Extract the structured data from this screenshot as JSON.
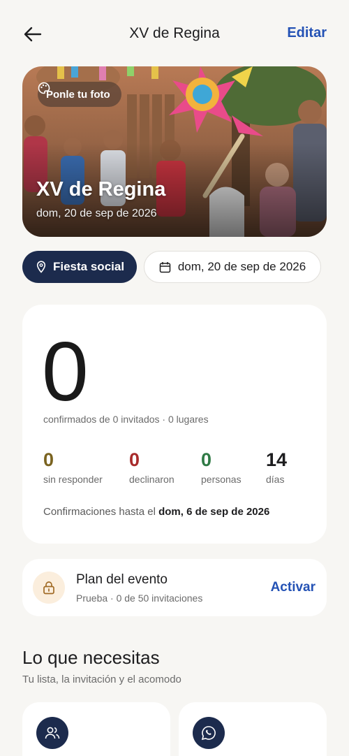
{
  "header": {
    "title": "XV de Regina",
    "edit_label": "Editar"
  },
  "hero": {
    "photo_chip_label": "Ponle tu foto",
    "title": "XV de Regina",
    "date": "dom, 20 de sep de 2026"
  },
  "pills": {
    "type_label": "Fiesta social",
    "date_label": "dom, 20 de sep de 2026"
  },
  "stats": {
    "confirmed_count": "0",
    "confirmed_text": "confirmados de 0 invitados · 0 lugares",
    "metrics": [
      {
        "value": "0",
        "label": "sin responder",
        "color": "#7a6320"
      },
      {
        "value": "0",
        "label": "declinaron",
        "color": "#a82b2b"
      },
      {
        "value": "0",
        "label": "personas",
        "color": "#2f7a45"
      },
      {
        "value": "14",
        "label": "días",
        "color": "#1d1d1f"
      }
    ],
    "deadline_prefix": "Confirmaciones hasta el",
    "deadline_date": "dom, 6 de sep de 2026"
  },
  "plan": {
    "title": "Plan del evento",
    "subtitle": "Prueba · 0 de 50 invitaciones",
    "action_label": "Activar"
  },
  "needs": {
    "title": "Lo que necesitas",
    "subtitle": "Tu lista, la invitación y el acomodo",
    "tiles": [
      {
        "icon": "users-icon"
      },
      {
        "icon": "whatsapp-icon"
      }
    ]
  },
  "colors": {
    "accent_blue": "#2452b5",
    "navy": "#1c2b4d",
    "background": "#f7f6f3"
  }
}
